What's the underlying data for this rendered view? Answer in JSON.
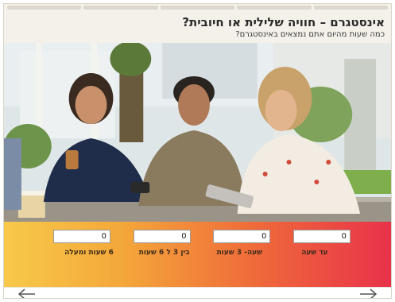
{
  "header": {
    "title": "אינסטגרם – חוויה שלילית או חיובית?",
    "subtitle": "כמה שעות מהיום אתם נמצאים באינסטגרם?"
  },
  "scene": {
    "description_icon": "photo-four-people-with-phones"
  },
  "survey": {
    "options": [
      {
        "label": "עד שעה",
        "value": "0"
      },
      {
        "label": "שעה- 3 שעות",
        "value": "0"
      },
      {
        "label": "בין 3 ל 6 שעות",
        "value": "0"
      },
      {
        "label": "6 שעות ומעלה",
        "value": "0"
      }
    ]
  },
  "nav": {
    "prev_icon": "arrow-left-icon",
    "next_icon": "arrow-right-icon"
  },
  "colors": {
    "gradient_start": "#f7c94a",
    "gradient_mid": "#ef6a3a",
    "gradient_end": "#e8324a",
    "background": "#f4f1ea"
  }
}
